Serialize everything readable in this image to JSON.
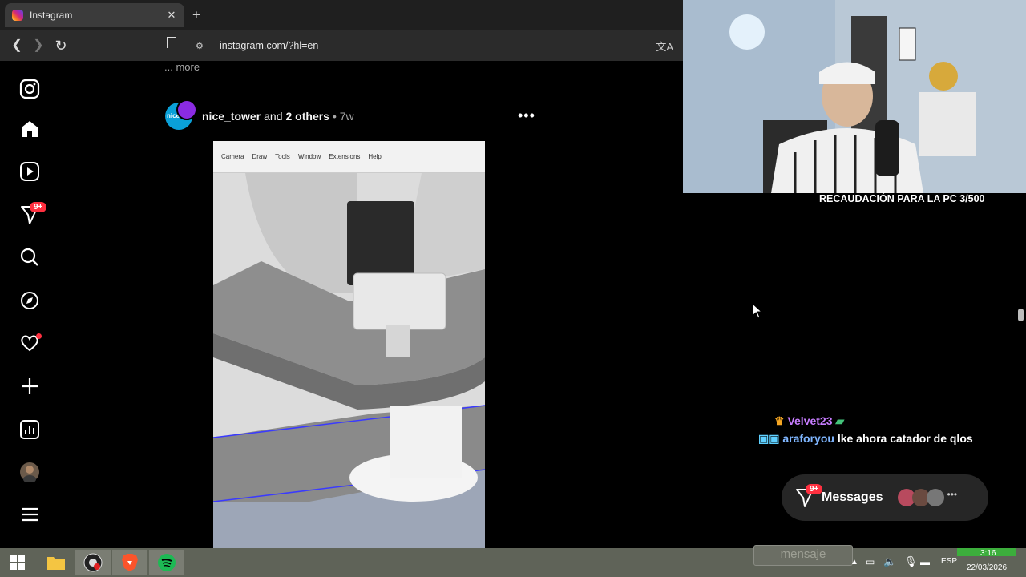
{
  "browser": {
    "tab_title": "Instagram",
    "url": "instagram.com/?hl=en"
  },
  "sidebar": {
    "notifications_badge": "9+",
    "items": [
      {
        "name": "instagram-icon"
      },
      {
        "name": "home-icon"
      },
      {
        "name": "reels-icon"
      },
      {
        "name": "messages-icon"
      },
      {
        "name": "search-icon"
      },
      {
        "name": "explore-icon"
      },
      {
        "name": "heart-icon"
      },
      {
        "name": "plus-icon"
      },
      {
        "name": "insights-icon"
      },
      {
        "name": "avatar"
      },
      {
        "name": "hamburger-icon"
      }
    ]
  },
  "feed": {
    "more_label": "... more",
    "post": {
      "username": "nice_tower",
      "and_text": "and",
      "others": "2 others",
      "time": "• 7w",
      "avatar_text": "nice",
      "video_menu": [
        "Camera",
        "Draw",
        "Tools",
        "Window",
        "Extensions",
        "Help"
      ]
    }
  },
  "stream": {
    "overlay_title": "RECAUDACIÓN PARA LA PC 3/500",
    "chat": [
      {
        "user": "Velvet23",
        "message": ""
      },
      {
        "user": "araforyou",
        "message": "lke ahora catador de qlos"
      }
    ],
    "ghost_input": "mensaje"
  },
  "messages_bar": {
    "label": "Messages",
    "badge": "9+"
  },
  "taskbar": {
    "language": "ESP",
    "time": "3:16",
    "date": "22/03/2026"
  },
  "colors": {
    "notification_red": "#ff3040",
    "chat_user_purple": "#c77dff",
    "chat_user_blue": "#7fb6ff",
    "spotify_green": "#1db954"
  }
}
